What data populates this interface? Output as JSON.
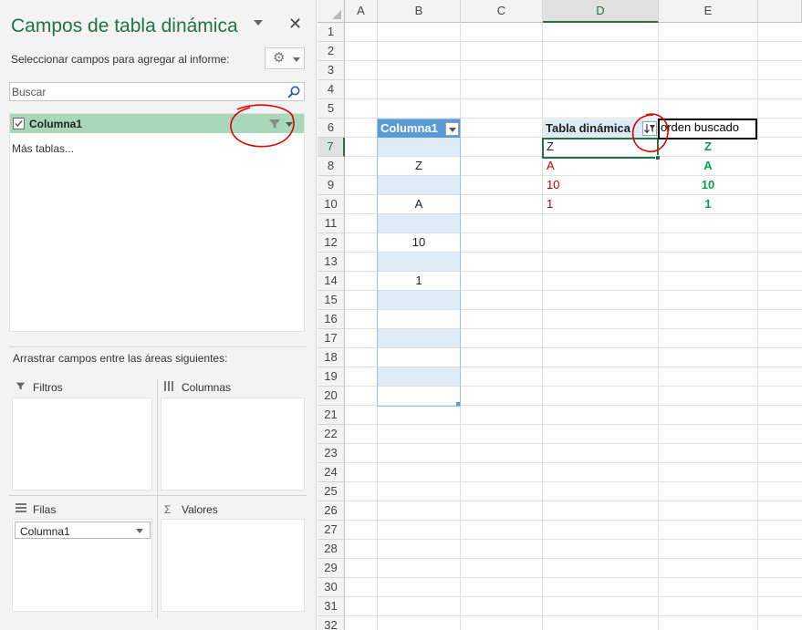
{
  "panel": {
    "title": "Campos de tabla dinámica",
    "close_glyph": "✕",
    "subtitle": "Seleccionar campos para agregar al informe:",
    "gear_icon": "gear-icon",
    "search_placeholder": "Buscar",
    "fields": [
      {
        "label": "Columna1",
        "checked": true,
        "filtered": true
      }
    ],
    "more_tables": "Más tablas...",
    "areas_hint": "Arrastrar campos entre las áreas siguientes:",
    "areas": {
      "filters": {
        "label": "Filtros",
        "icon": "filter-icon",
        "items": []
      },
      "columns": {
        "label": "Columnas",
        "icon": "columns-icon",
        "items": []
      },
      "rows": {
        "label": "Filas",
        "icon": "rows-icon",
        "items": [
          "Columna1"
        ]
      },
      "values": {
        "label": "Valores",
        "icon": "sigma-icon",
        "items": []
      }
    },
    "accent_color": "#217346",
    "field_row_color": "#a9d7b9"
  },
  "sheet": {
    "columns": [
      "A",
      "B",
      "C",
      "D",
      "E"
    ],
    "active_column": "D",
    "rows": [
      "1",
      "2",
      "3",
      "4",
      "5",
      "6",
      "7",
      "8",
      "9",
      "10",
      "11",
      "12",
      "13",
      "14",
      "15",
      "16",
      "17",
      "18",
      "19",
      "20",
      "21",
      "22",
      "23",
      "24",
      "25",
      "26",
      "27",
      "28",
      "29",
      "30",
      "31",
      "32"
    ],
    "active_row": "7",
    "table_b": {
      "header": "Columna1",
      "values": [
        "",
        "Z",
        "",
        "A",
        "",
        "10",
        "",
        "1",
        "",
        "",
        "",
        "",
        "",
        ""
      ]
    },
    "pivot_d": {
      "header": "Tabla dinámica",
      "values": [
        "Z",
        "A",
        "10",
        "1"
      ],
      "value_color": "#c00000"
    },
    "column_e": {
      "header": "orden buscado",
      "values": [
        "Z",
        "A",
        "10",
        "1"
      ],
      "value_color": "#00a14b"
    },
    "table_header_color": "#5b9bd5",
    "table_band_color": "#ddebf7"
  }
}
